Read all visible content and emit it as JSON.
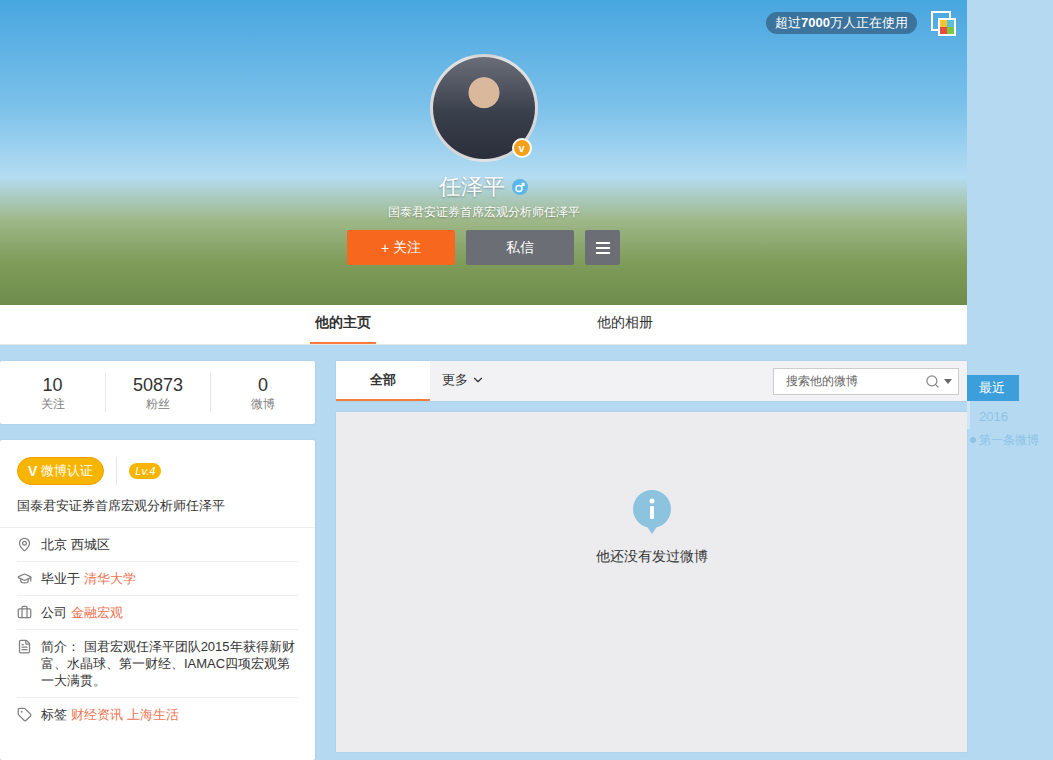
{
  "top_badge": {
    "prefix": "超过",
    "count": "7000",
    "suffix": "万人正在使用"
  },
  "profile": {
    "name": "任泽平",
    "gender": "male",
    "verified_mark": "v",
    "subtitle": "国泰君安证券首席宏观分析师任泽平"
  },
  "actions": {
    "follow": {
      "icon": "+",
      "label": "关注"
    },
    "message": "私信"
  },
  "tabs": [
    {
      "label": "他的主页",
      "selected": true
    },
    {
      "label": "他的相册",
      "selected": false
    }
  ],
  "stats": [
    {
      "value": "10",
      "label": "关注"
    },
    {
      "value": "50873",
      "label": "粉丝"
    },
    {
      "value": "0",
      "label": "微博"
    }
  ],
  "info": {
    "verified": {
      "mark": "V",
      "label": "微博认证"
    },
    "level": "Lv.4",
    "description": "国泰君安证券首席宏观分析师任泽平",
    "rows": [
      {
        "kind": "location",
        "text": "北京 西城区"
      },
      {
        "kind": "school",
        "label": "毕业于",
        "links": [
          "清华大学"
        ]
      },
      {
        "kind": "company",
        "label": "公司",
        "links": [
          "金融宏观"
        ]
      },
      {
        "kind": "intro",
        "label": "简介：",
        "text": "国君宏观任泽平团队2015年获得新财富、水晶球、第一财经、IAMAC四项宏观第一大满贯。"
      },
      {
        "kind": "tags",
        "label": "标签",
        "links": [
          "财经资讯",
          "上海生活"
        ]
      }
    ]
  },
  "feed": {
    "tabs": [
      {
        "label": "全部",
        "selected": true,
        "dropdown": false
      },
      {
        "label": "更多",
        "selected": false,
        "dropdown": true
      }
    ],
    "search": {
      "placeholder": "搜索他的微博"
    },
    "empty": "他还没有发过微博"
  },
  "timeline": [
    {
      "label": "最近",
      "kind": "section",
      "selected": true
    },
    {
      "label": "2016",
      "kind": "year",
      "selected": false
    },
    {
      "label": "第一条微博",
      "kind": "event",
      "selected": false
    }
  ]
}
